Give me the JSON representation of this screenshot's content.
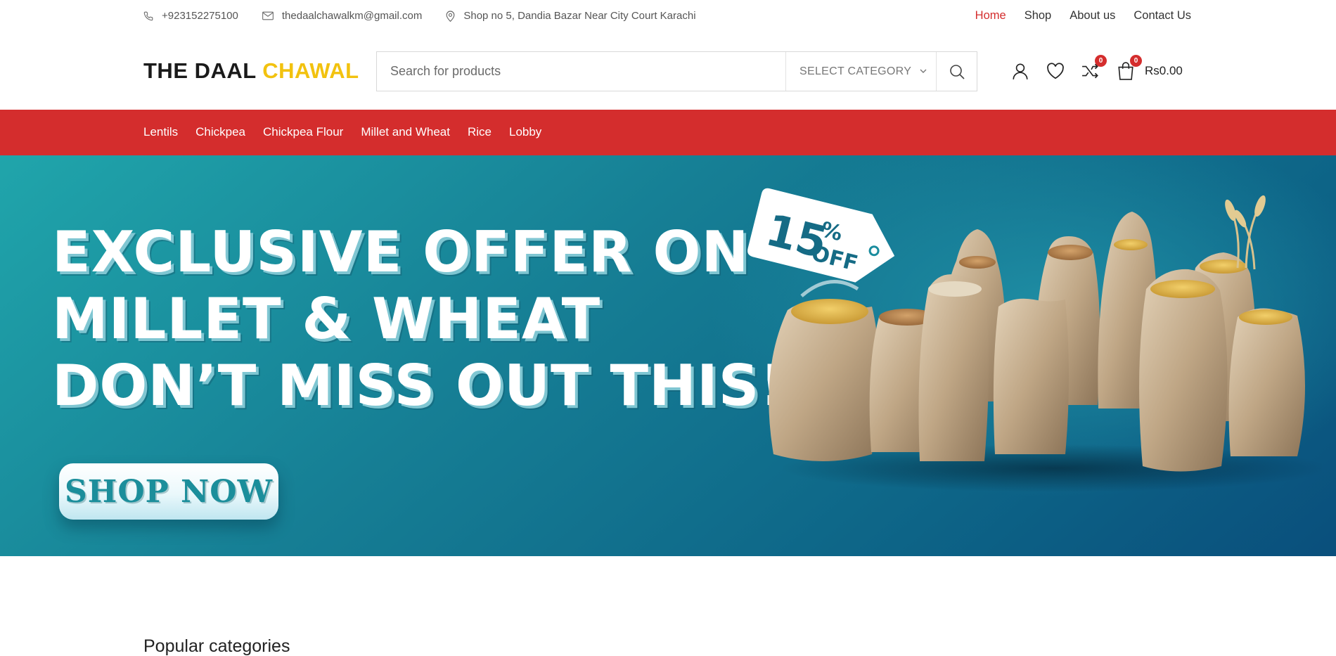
{
  "topbar": {
    "phone": "+923152275100",
    "email": "thedaalchawalkm@gmail.com",
    "address": "Shop no 5, Dandia Bazar Near City Court Karachi",
    "nav": [
      {
        "label": "Home",
        "active": true
      },
      {
        "label": "Shop",
        "active": false
      },
      {
        "label": "About us",
        "active": false
      },
      {
        "label": "Contact Us",
        "active": false
      }
    ]
  },
  "header": {
    "logo_main": "THE DAAL",
    "logo_accent": "CHAWAL",
    "search_placeholder": "Search for products",
    "category_select": "SELECT CATEGORY",
    "compare_count": "0",
    "cart_count": "0",
    "cart_total": "Rs0.00",
    "icons": [
      "phone-icon",
      "mail-icon",
      "map-pin-icon",
      "search-icon",
      "user-icon",
      "heart-icon",
      "shuffle-icon",
      "cart-icon"
    ]
  },
  "categories": [
    "Lentils",
    "Chickpea",
    "Chickpea Flour",
    "Millet and Wheat",
    "Rice",
    "Lobby"
  ],
  "hero": {
    "line1": "EXCLUSIVE OFFER ON",
    "line2": "MILLET & WHEAT",
    "line3": "DON’T MISS OUT THIS!",
    "button": "SHOP NOW",
    "tag_percent": "15",
    "tag_percent_sign": "%",
    "tag_off": "OFF"
  },
  "sections": {
    "popular_title": "Popular categories"
  },
  "colors": {
    "accent_red": "#d42d2d",
    "logo_yellow": "#f2c20f",
    "hero_teal": "#1a8c9e"
  }
}
